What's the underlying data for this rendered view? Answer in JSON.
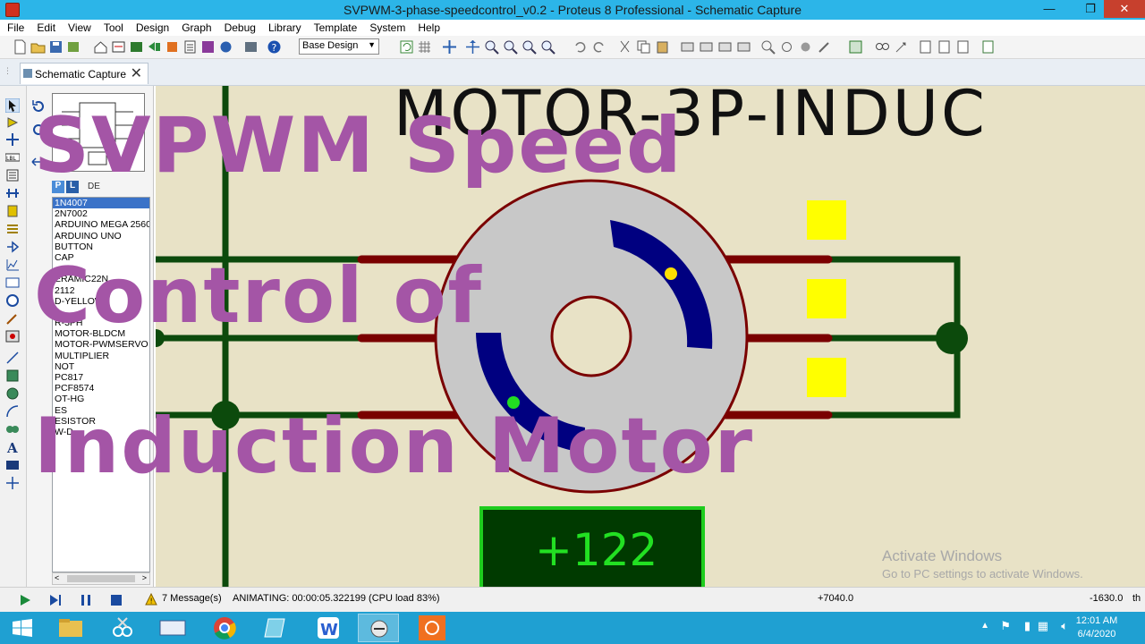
{
  "window": {
    "title": "SVPWM-3-phase-speedcontrol_v0.2 - Proteus 8 Professional - Schematic Capture",
    "minimize": "—",
    "restore": "❐",
    "close": "✕"
  },
  "menu": [
    "File",
    "Edit",
    "View",
    "Tool",
    "Design",
    "Graph",
    "Debug",
    "Library",
    "Template",
    "System",
    "Help"
  ],
  "toolbar": {
    "design_select": "Base Design"
  },
  "tab": {
    "label": "Schematic Capture",
    "close": "✕"
  },
  "library": {
    "p_button": "P",
    "l_button": "L",
    "devices_label": "DE",
    "parts": [
      "1N4007",
      "2N7002",
      "ARDUINO MEGA 2560",
      "ARDUINO UNO",
      "BUTTON",
      "CAP",
      "",
      "ERAMIC22N",
      "2112",
      "D-YELLOW",
      "",
      "R-3PH",
      "MOTOR-BLDCM",
      "MOTOR-PWMSERVO",
      "MULTIPLIER",
      "NOT",
      "PC817",
      "PCF8574",
      "OT-HG",
      "ES",
      "ESISTOR",
      "W-D"
    ],
    "selected_index": 0,
    "scroll_left": "<",
    "scroll_right": ">"
  },
  "canvas": {
    "component_label": "MOTOR-3P-INDUC",
    "display_value": "+122"
  },
  "overlay": {
    "line1": "SVPWM Speed",
    "line2": "Control of",
    "line3": "Induction Motor"
  },
  "watermark": {
    "line1": "Activate Windows",
    "line2": "Go to PC settings to activate Windows."
  },
  "status": {
    "messages": "7 Message(s)",
    "animating": "ANIMATING: 00:00:05.322199 (CPU load 83%)",
    "coord_x": "+7040.0",
    "coord_y": "-1630.0",
    "unit": "th"
  },
  "taskbar": {
    "time": "12:01 AM",
    "date": "6/4/2020"
  },
  "colors": {
    "titlebar": "#2cb5e8",
    "canvas_bg": "#e8e2c6",
    "wire": "#0c4a0c",
    "pin": "#7a0000",
    "rotor": "#000080",
    "overlay": "#a455a6",
    "display_bg": "#003a00",
    "display_fg": "#22e022"
  }
}
